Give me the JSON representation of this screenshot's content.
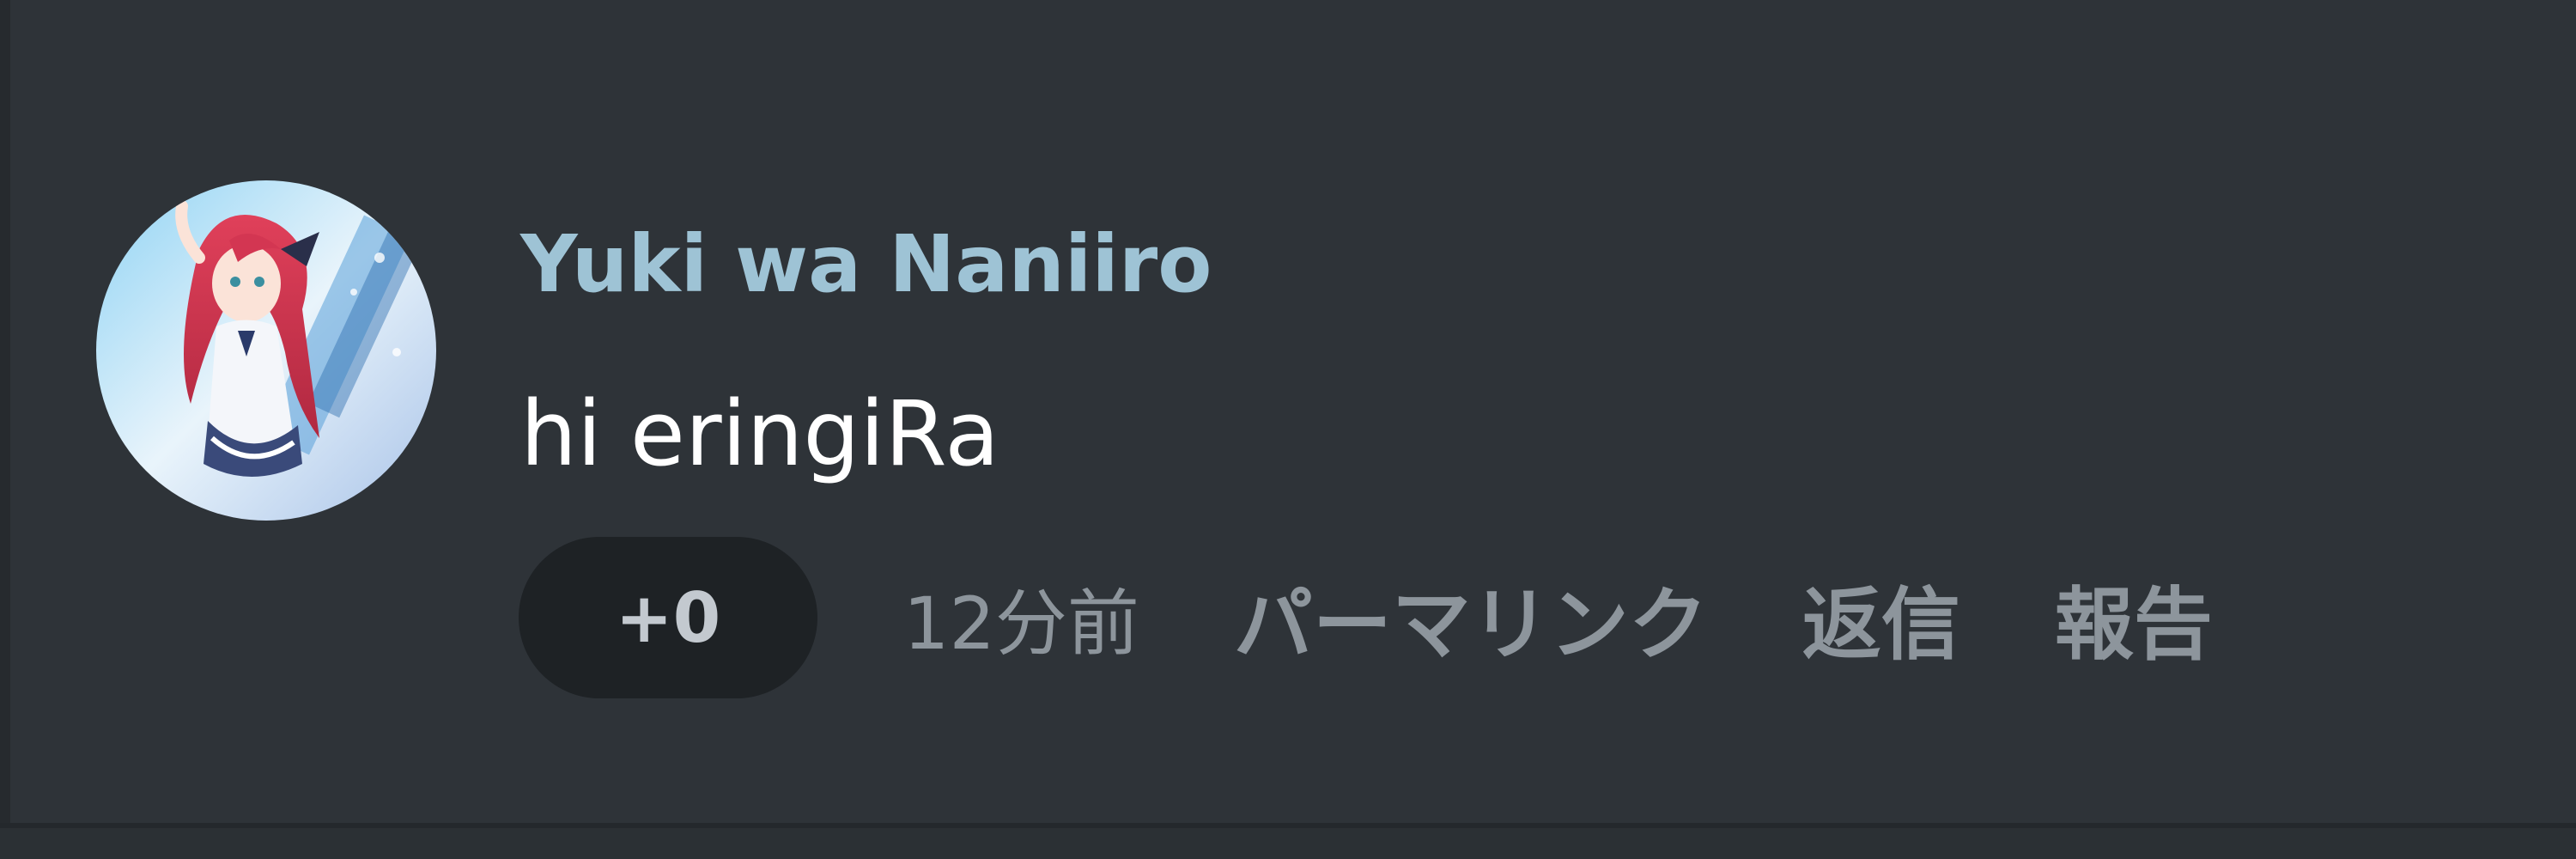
{
  "comment": {
    "username": "Yuki wa Naniiro",
    "text": "hi eringiRa",
    "vote_count": "+0",
    "timestamp": "12分前",
    "actions": {
      "permalink": "パーマリンク",
      "reply": "返信",
      "report": "報告"
    },
    "avatar_icon": "user-avatar-anime-girl"
  },
  "colors": {
    "background": "#2e3338",
    "username": "#9ec3d5",
    "text": "#ffffff",
    "muted": "#8d959c",
    "pill": "#1e2225"
  }
}
